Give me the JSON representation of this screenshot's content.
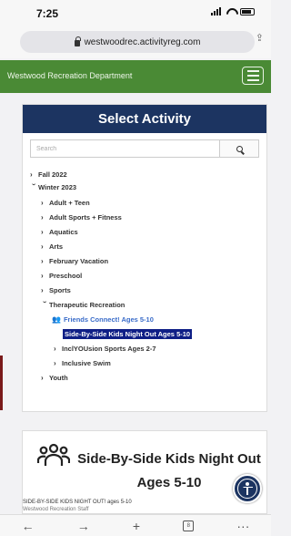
{
  "status_bar": {
    "time": "7:25"
  },
  "browser": {
    "url": "westwoodrec.activityreg.com"
  },
  "site": {
    "title": "Westwood Recreation Department"
  },
  "select_activity": {
    "heading": "Select Activity",
    "search_placeholder": "Search",
    "tree": [
      {
        "label": "Fall 2022"
      },
      {
        "label": "Winter 2023"
      },
      {
        "label": "Adult + Teen"
      },
      {
        "label": "Adult Sports + Fitness"
      },
      {
        "label": "Aquatics"
      },
      {
        "label": "Arts"
      },
      {
        "label": "February Vacation"
      },
      {
        "label": "Preschool"
      },
      {
        "label": "Sports"
      },
      {
        "label": "Therapeutic Recreation"
      },
      {
        "label": "Friends Connect! Ages 5-10"
      },
      {
        "label": "Side-By-Side Kids Night Out Ages 5-10"
      },
      {
        "label": "InclYOUsion Sports Ages 2-7"
      },
      {
        "label": "Inclusive Swim"
      },
      {
        "label": "Youth"
      }
    ]
  },
  "detail": {
    "title": "Side-By-Side Kids Night Out Ages 5-10",
    "description_line1": "SIDE-BY-SIDE KIDS NIGHT OUT! ages 5-10",
    "description_line2": "Westwood Recreation Staff"
  },
  "toolbar": {
    "back": "←",
    "forward": "→",
    "new_tab": "+",
    "tabs_count": "8",
    "more": "···"
  },
  "colors": {
    "site_green": "#4a8a35",
    "header_navy": "#1c3461",
    "selected_bg": "#0f1f86",
    "link_blue": "#3a6cc9"
  }
}
